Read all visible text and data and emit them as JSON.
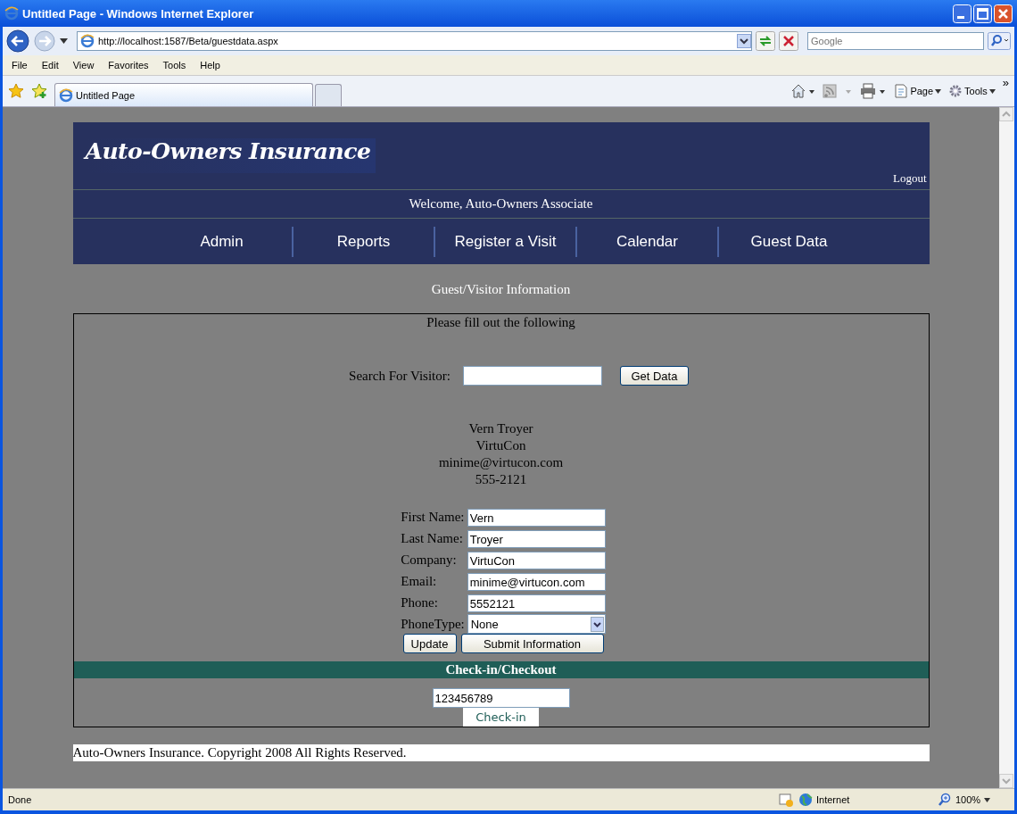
{
  "window": {
    "title": "Untitled Page - Windows Internet Explorer"
  },
  "address_bar": {
    "url": "http://localhost:1587/Beta/guestdata.aspx",
    "search_placeholder": "Google"
  },
  "menu": [
    "File",
    "Edit",
    "View",
    "Favorites",
    "Tools",
    "Help"
  ],
  "tabs": [
    {
      "label": "Untitled Page",
      "selected": true
    }
  ],
  "command_bar": {
    "page": "Page",
    "tools": "Tools",
    "more": "»"
  },
  "page": {
    "logo": "Auto-Owners Insurance",
    "logout": "Logout",
    "welcome": "Welcome, Auto-Owners Associate",
    "nav": [
      "Admin",
      "Reports",
      "Register a Visit",
      "Calendar",
      "Guest Data"
    ],
    "heading": "Guest/Visitor Information",
    "form": {
      "instruction": "Please fill out the following",
      "search_label": "Search For Visitor:",
      "search_button": "Get Data",
      "visitor": [
        "Vern Troyer",
        "VirtuCon",
        "minime@virtucon.com",
        "555-2121"
      ],
      "fields": [
        {
          "label": "First Name:",
          "value": "Vern",
          "kind": "text"
        },
        {
          "label": "Last Name:",
          "value": "Troyer",
          "kind": "text"
        },
        {
          "label": "Company:",
          "value": "VirtuCon",
          "kind": "text"
        },
        {
          "label": "Email:",
          "value": "minime@virtucon.com",
          "kind": "text"
        },
        {
          "label": "Phone:",
          "value": "5552121",
          "kind": "text"
        },
        {
          "label": "PhoneType:",
          "value": "None",
          "kind": "select"
        }
      ],
      "buttons": [
        "Update",
        "Submit Information"
      ]
    },
    "checkin": {
      "title": "Check-in/Checkout",
      "value": "123456789",
      "button": "Check-in"
    },
    "footer": "Auto-Owners Insurance. Copyright 2008 All Rights Reserved."
  },
  "status_bar": {
    "text": "Done",
    "zone": "Internet",
    "zoom": "100%"
  }
}
